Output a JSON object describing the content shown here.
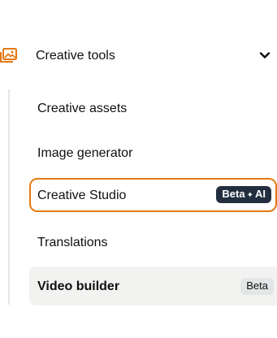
{
  "section": {
    "title": "Creative tools",
    "icon": "image-gallery-icon",
    "accent": "#e47911",
    "expanded": true
  },
  "items": [
    {
      "label": "Creative assets"
    },
    {
      "label": "Image generator"
    },
    {
      "label": "Creative Studio",
      "badge_left": "Beta",
      "badge_right": "AI",
      "badge_icon": "sparkle-icon",
      "state": "focused"
    },
    {
      "label": "Translations"
    },
    {
      "label": "Video builder",
      "badge": "Beta",
      "state": "active"
    }
  ],
  "colors": {
    "focus_border": "#e47911",
    "dark_badge": "#232f3e",
    "active_bg": "#f2f2f0",
    "light_badge": "#e3e6e6"
  }
}
